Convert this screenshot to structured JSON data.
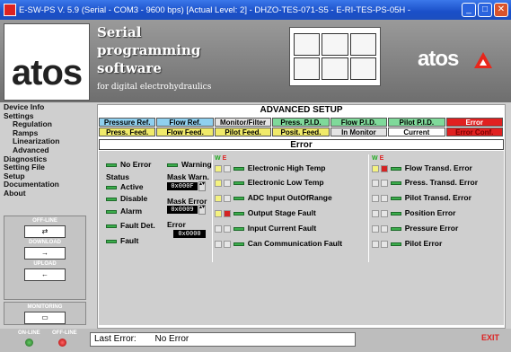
{
  "window": {
    "title": "E-SW-PS  V. 5.9   (Serial - COM3 - 9600 bps)    [Actual Level: 2]    - DHZO-TES-071-S5 - E-RI-TES-PS-05H -"
  },
  "header": {
    "logo": "atos",
    "title_lines": [
      "Serial",
      "programming",
      "software"
    ],
    "subtitle": "for digital electrohydraulics",
    "brand": "atos"
  },
  "sidebar": {
    "items": [
      "Device Info",
      "Settings",
      "Regulation",
      "Ramps",
      "Linearization",
      "Advanced",
      "Diagnostics",
      "Setting File",
      "Setup",
      "Documentation",
      "About"
    ],
    "offline_label": "OFF-LINE",
    "download_label": "DOWNLOAD",
    "upload_label": "UPLOAD",
    "monitoring_label": "MONITORING"
  },
  "footer": {
    "online_label": "ON-LINE",
    "offline_label": "OFF-LINE",
    "last_error_label": "Last Error:",
    "last_error_value": "No Error",
    "exit_label": "EXIT"
  },
  "advanced": {
    "title": "ADVANCED SETUP",
    "tabs_row1": [
      "Pressure Ref.",
      "Flow Ref.",
      "Monitor/Filter",
      "Press. P.I.D.",
      "Flow P.I.D.",
      "Pilot P.I.D.",
      "Error"
    ],
    "tabs_row2": [
      "Press. Feed.",
      "Flow Feed.",
      "Pilot Feed.",
      "Posit. Feed.",
      "In Monitor",
      "Current",
      "Error Conf."
    ],
    "section": "Error"
  },
  "status": {
    "no_error": "No Error",
    "warning": "Warning",
    "status_label": "Status",
    "items": [
      "Active",
      "Disable",
      "Alarm",
      "Fault Det.",
      "Fault"
    ],
    "mask_warn_label": "Mask Warn.",
    "mask_warn_value": "0x000F",
    "mask_error_label": "Mask Error",
    "mask_error_value": "0x0009",
    "error_label": "Error",
    "error_value": "0x0000"
  },
  "col_headers": {
    "w": "W",
    "e": "E"
  },
  "errors_left": [
    "Electronic High Temp",
    "Electronic Low Temp",
    "ADC Input OutOfRange",
    "Output Stage Fault",
    "Input Current Fault",
    "Can Communication Fault"
  ],
  "errors_right": [
    "Flow Transd. Error",
    "Press. Transd. Error",
    "Pilot Transd. Error",
    "Position Error",
    "Pressure Error",
    "Pilot Error"
  ]
}
